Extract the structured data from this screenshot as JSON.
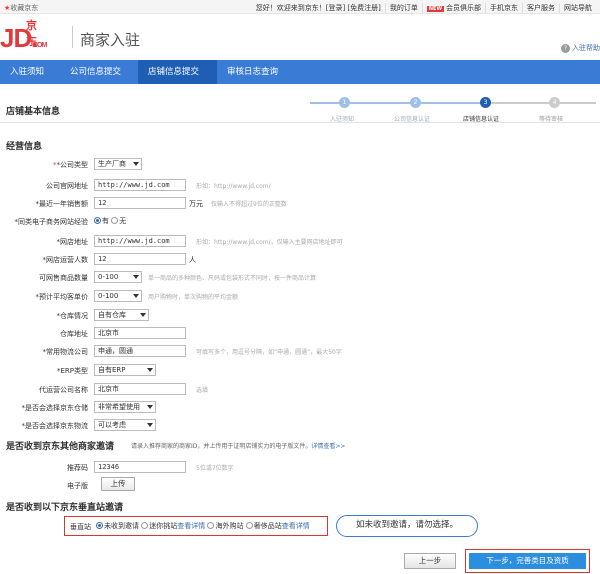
{
  "topbar": {
    "favorite": "收藏京东",
    "greeting": "您好！欢迎来到京东！[登录] [免费注册]",
    "links": [
      "我的订单",
      "会员俱乐部",
      "手机京东",
      "客户服务",
      "网站导航"
    ],
    "new_badge": "NEW"
  },
  "header": {
    "logo_main": "JD.",
    "logo_cn": "京东",
    "logo_com": "COM",
    "title": "商家入驻",
    "help": "入驻帮助",
    "help_icon": "?"
  },
  "nav": {
    "tabs": [
      "入驻须知",
      "公司信息提交",
      "店铺信息提交",
      "审核日志查询"
    ],
    "active_index": 2
  },
  "section": {
    "title": "店铺基本信息",
    "steps": [
      {
        "num": "1",
        "label": "入驻须知"
      },
      {
        "num": "2",
        "label": "公司信息认证"
      },
      {
        "num": "3",
        "label": "店铺信息认证"
      },
      {
        "num": "4",
        "label": "等待审核"
      }
    ]
  },
  "operation": {
    "title": "经营信息",
    "company_type_label": "*公司类型",
    "company_type_value": "生产厂商",
    "website_label": "公司官网地址",
    "website_value": "http://www.jd.com",
    "website_hint": "形如：http://www.jd.com/",
    "turnover_label": "*最近一年销售额",
    "turnover_value": "12",
    "turnover_unit": "万元",
    "turnover_hint": "仅输入不得超过9位的正整数",
    "ecommerce_label": "*同类电子商务网站经验",
    "ecommerce_yes": "有",
    "ecommerce_no": "无",
    "shop_url_label": "*网店地址",
    "shop_url_value": "http://www.jd.com",
    "shop_url_hint": "形如：http://www.jd.com/，仅输入主要网店地址即可",
    "ops_count_label": "*网店运营人数",
    "ops_count_value": "12",
    "ops_count_unit": "人",
    "sku_label": "可网售商品数量",
    "sku_value": "0-100",
    "sku_hint": "单一商品的多种颜色、尺码或包装形式不同时，按一件商品计算",
    "avg_price_label": "*预计平均客单价",
    "avg_price_value": "0-100",
    "avg_price_hint": "用户购物时，单次购物的平均金额",
    "warehouse_label": "*仓库情况",
    "warehouse_value": "自有仓库",
    "warehouse_addr_label": "仓库地址",
    "warehouse_addr_value": "北京市",
    "logistics_label": "*常用物流公司",
    "logistics_value": "申通，圆通",
    "logistics_hint": "可填写多个，用逗号分隔，如“申通，圆通”，最大50字",
    "erp_label": "*ERP类型",
    "erp_value": "自有ERP",
    "agency_label": "代运营公司名称",
    "agency_value": "北京市",
    "agency_hint": "选填",
    "jd_warehouse_label": "*是否会选择京东仓储",
    "jd_warehouse_value": "非常希望使用",
    "jd_logistics_label": "*是否会选择京东物流",
    "jd_logistics_value": "可以考虑"
  },
  "invite": {
    "title": "是否收到京东其他商家邀请",
    "desc": "请录入推荐商家的商家ID，并上传用于证明店铺实力的电子版文件。",
    "desc_link": "详情查看>>",
    "code_label": "推荐码",
    "code_value": "12346",
    "code_hint": "5位或7位数字",
    "file_label": "电子版",
    "upload_label": "上传"
  },
  "vertical": {
    "title": "是否收到以下京东垂直站邀请",
    "label": "垂直站",
    "options": [
      "未收到邀请",
      "迷你挑站",
      "查看详情",
      "海外购站",
      "奢侈品站",
      "查看详情"
    ],
    "callout": "如未收到邀请，请勿选择。"
  },
  "footer": {
    "prev": "上一步",
    "next": "下一步，完善类目及资质"
  }
}
